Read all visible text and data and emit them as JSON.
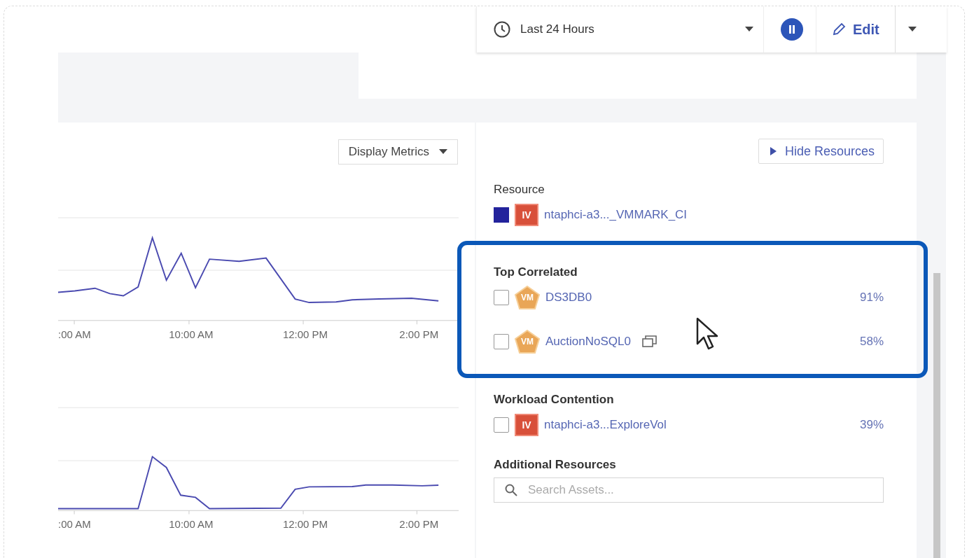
{
  "toolbar": {
    "time_range": {
      "value": "Last 24 Hours"
    },
    "paused": true,
    "edit_button": {
      "label": "Edit"
    }
  },
  "display_metrics": {
    "label": "Display Metrics"
  },
  "charts": [
    {
      "x_labels": [
        ":00 AM",
        "10:00 AM",
        "12:00 PM",
        "2:00 PM"
      ]
    },
    {
      "x_labels": [
        ":00 AM",
        "10:00 AM",
        "12:00 PM",
        "2:00 PM"
      ]
    }
  ],
  "resources_panel": {
    "hide_button": {
      "label": "Hide Resources"
    },
    "resource": {
      "heading": "Resource",
      "color": "#23239c",
      "item": {
        "kind": "volume",
        "badge": "IV",
        "name": "ntaphci-a3..._VMMARK_CI"
      }
    },
    "top_correlated": {
      "heading": "Top Correlated",
      "highlighted": true,
      "items": [
        {
          "kind": "vm",
          "badge": "VM",
          "name": "DS3DB0",
          "checked": false,
          "copy_icon": false,
          "percent": "91%"
        },
        {
          "kind": "vm",
          "badge": "VM",
          "name": "AuctionNoSQL0",
          "checked": false,
          "copy_icon": true,
          "percent": "58%"
        }
      ]
    },
    "workload_contention": {
      "heading": "Workload Contention",
      "items": [
        {
          "kind": "volume",
          "badge": "IV",
          "name": "ntaphci-a3...ExploreVol",
          "checked": false,
          "copy_icon": false,
          "percent": "39%"
        }
      ]
    },
    "additional_resources": {
      "heading": "Additional Resources",
      "search": {
        "placeholder": "Search Assets..."
      }
    }
  }
}
